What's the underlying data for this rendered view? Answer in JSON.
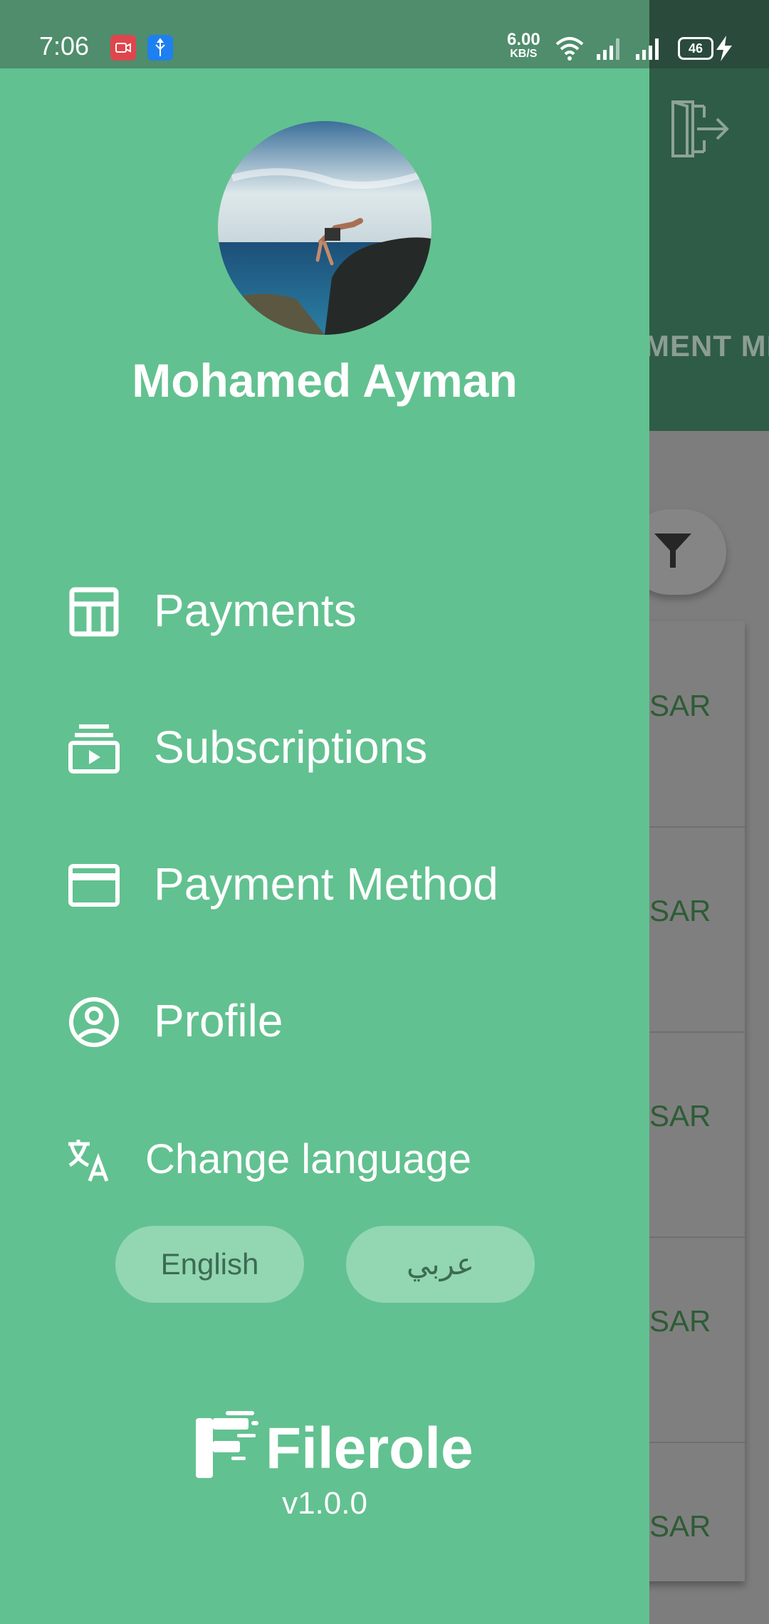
{
  "status_bar": {
    "time": "7:06",
    "net_speed_value": "6.00",
    "net_speed_unit": "KB/S",
    "battery": "46"
  },
  "background": {
    "tab_label": "MENT MI",
    "currency": "SAR",
    "rows": [
      "SAR",
      "SAR",
      "SAR",
      "SAR",
      "SAR"
    ]
  },
  "drawer": {
    "user_name": "Mohamed Ayman",
    "menu": [
      {
        "label": "Payments",
        "icon": "receipt-icon"
      },
      {
        "label": "Subscriptions",
        "icon": "subscriptions-icon"
      },
      {
        "label": "Payment Method",
        "icon": "credit-card-icon"
      },
      {
        "label": "Profile",
        "icon": "account-circle-icon"
      }
    ],
    "change_language_label": "Change language",
    "lang_english": "English",
    "lang_arabic": "عربي",
    "brand": "Filerole",
    "version": "v1.0.0"
  },
  "colors": {
    "drawer_bg": "#62c190",
    "header_bg": "#2f5c46",
    "lang_button_bg": "#93d6b2"
  }
}
